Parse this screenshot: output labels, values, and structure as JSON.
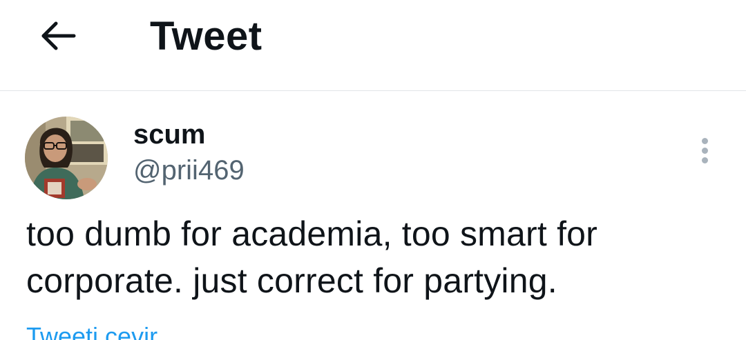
{
  "header": {
    "back_icon": "arrow-left-icon",
    "title": "Tweet"
  },
  "tweet": {
    "author": {
      "display_name": "scum",
      "handle": "@prii469",
      "avatar": "profile-photo"
    },
    "more_icon": "vertical-ellipsis-icon",
    "text": "too dumb for academia, too smart for corporate. just correct for partying.",
    "translate_label": "Tweeti çevir"
  },
  "colors": {
    "text": "#0f1419",
    "secondary_text": "#536471",
    "link": "#1d9bf0",
    "divider": "#e1e4e8"
  }
}
